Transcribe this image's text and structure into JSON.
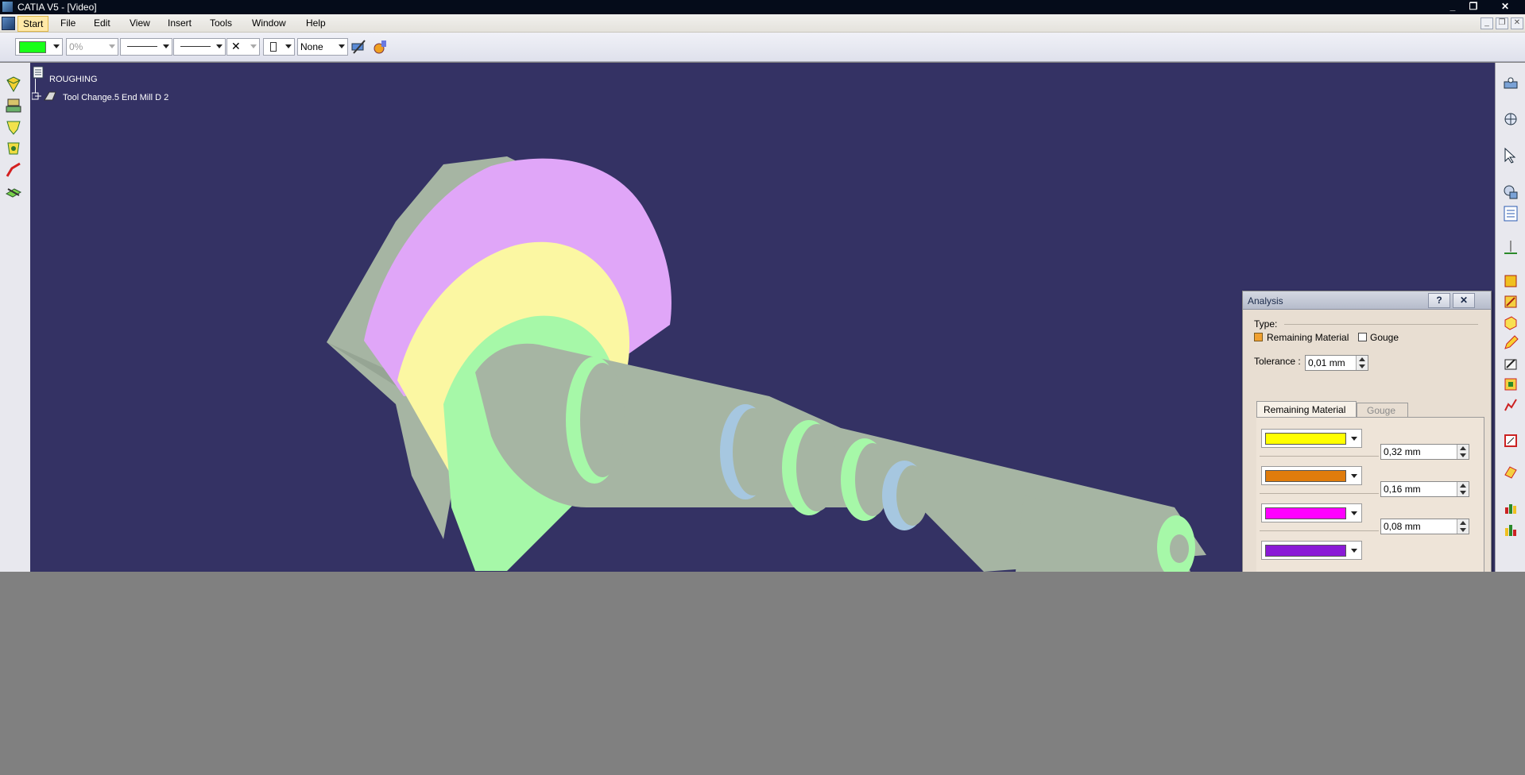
{
  "window": {
    "title": "CATIA V5 - [Video]",
    "controls": {
      "minimize": "_",
      "restore": "❐",
      "close": "✕"
    }
  },
  "menubar": {
    "items": [
      "Start",
      "File",
      "Edit",
      "View",
      "Insert",
      "Tools",
      "Window",
      "Help"
    ],
    "active": "Start",
    "mdi": {
      "minimize": "_",
      "restore": "❐",
      "close": "✕"
    }
  },
  "toolbar": {
    "fill_color": "#19ff19",
    "transparency": "0%",
    "layer": "None"
  },
  "tree": {
    "root": "ROUGHING",
    "child": "Tool Change.5  End Mill D 2"
  },
  "dialog": {
    "title": "Analysis",
    "help": "?",
    "close": "✕",
    "type_label": "Type:",
    "remaining_material_label": "Remaining Material",
    "gouge_label": "Gouge",
    "tolerance_label": "Tolerance :",
    "tolerance_value": "0,01 mm",
    "tabs": [
      "Remaining Material",
      "Gouge"
    ],
    "active_tab": "Remaining Material",
    "color_rows": [
      {
        "color": "#ffff00",
        "value": "0,32 mm"
      },
      {
        "color": "#e07c0c",
        "value": "0,16 mm"
      },
      {
        "color": "#ff00ff",
        "value": "0,08 mm"
      },
      {
        "color": "#8a1ad6",
        "value": ""
      }
    ]
  },
  "left_toolbar_icons": [
    "machining-op-icon",
    "tool-icon",
    "part-operation-icon",
    "program-icon",
    "tool-path-icon",
    "stock-icon"
  ],
  "right_toolbar_icons": [
    "view-icon",
    "compass-icon",
    "select-arrow-icon",
    "render-icon",
    "properties-icon",
    "axis-icon",
    "geometry-icon",
    "sketch-icon",
    "pad-icon",
    "pencil-icon",
    "feature-icon",
    "dimension-icon",
    "analysis-icon",
    "measure-icon",
    "chart-icon",
    "chart2-icon"
  ]
}
